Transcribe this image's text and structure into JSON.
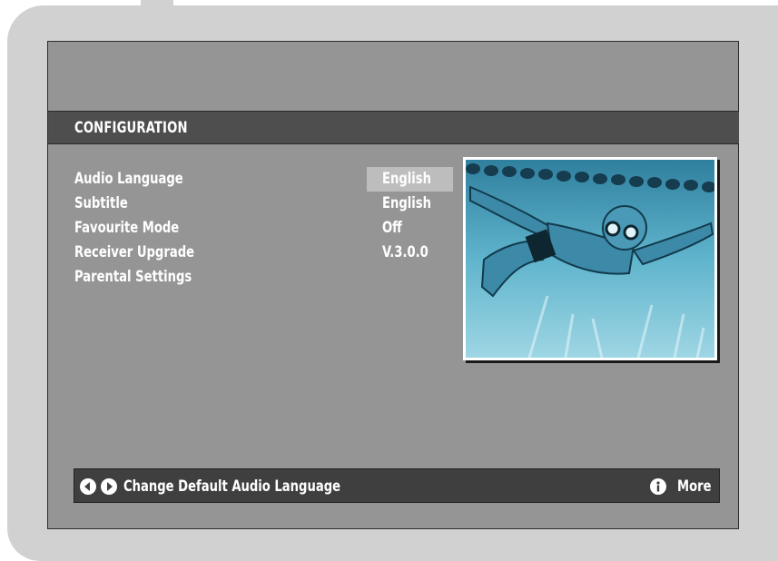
{
  "screen": {
    "title": "CONFIGURATION"
  },
  "menu": {
    "items": [
      {
        "label": "Audio Language",
        "value": "English",
        "selected": true
      },
      {
        "label": "Subtitle",
        "value": "English"
      },
      {
        "label": "Favourite Mode",
        "value": "Off"
      },
      {
        "label": "Receiver Upgrade",
        "value": "V.3.0.0"
      },
      {
        "label": "Parental Settings",
        "value": ""
      }
    ]
  },
  "help_bar": {
    "hint": "Change Default Audio Language",
    "more_label": "More",
    "icons": [
      "arrow-left-icon",
      "arrow-right-icon",
      "info-icon"
    ]
  },
  "preview_image": {
    "subject": "underwater-swimmer-photo"
  },
  "colors": {
    "panel_bg": "#959595",
    "title_bar": "#4e4e4e",
    "highlight": "#bdbdbd",
    "help_bar": "#3f3f3f",
    "water": "#5fb4cc"
  }
}
